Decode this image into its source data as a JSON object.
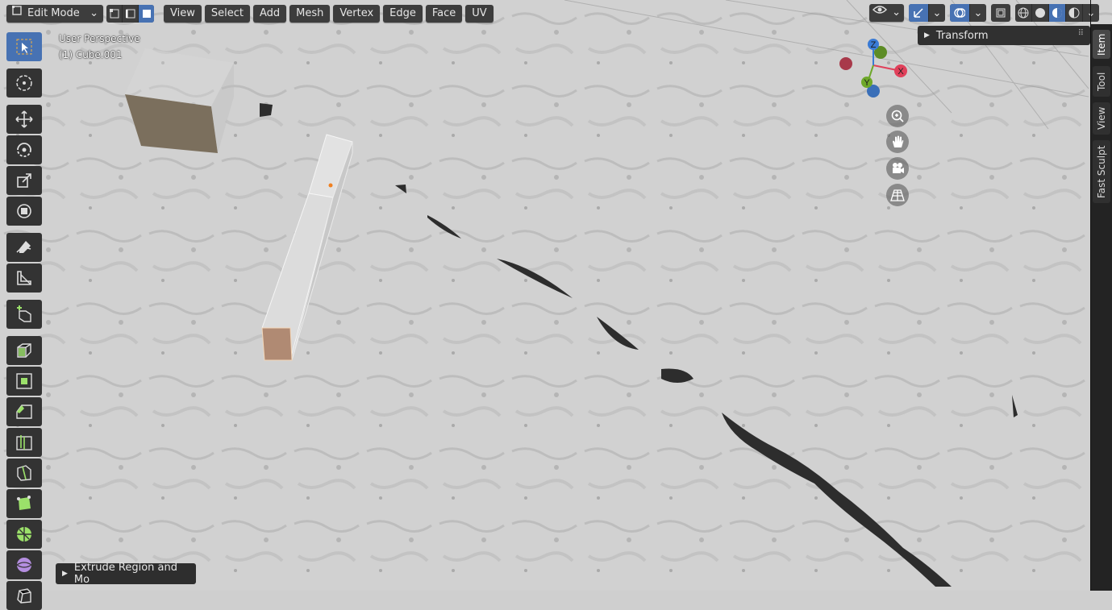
{
  "header": {
    "mode": "Edit Mode",
    "menus": [
      "View",
      "Select",
      "Add",
      "Mesh",
      "Vertex",
      "Edge",
      "Face",
      "UV"
    ],
    "select_modes": [
      "vertex-select",
      "edge-select",
      "face-select"
    ],
    "active_select_mode": "face-select"
  },
  "viewport": {
    "perspective": "User Perspective",
    "object": "(1) Cube.001"
  },
  "gizmo": {
    "x": "X",
    "y": "Y",
    "z": "Z"
  },
  "npanel": {
    "transform_label": "Transform",
    "tabs": [
      "Item",
      "Tool",
      "View",
      "Fast Sculpt"
    ],
    "active_tab": "Item"
  },
  "last_operator": {
    "label": "Extrude Region and Mo"
  },
  "toolbar": {
    "tools": [
      "select-box",
      "cursor",
      "move",
      "rotate",
      "scale",
      "transform",
      "annotate",
      "measure",
      "add-cube",
      "extrude-region",
      "inset-faces",
      "bevel",
      "loop-cut",
      "knife",
      "poly-build",
      "spin",
      "smooth",
      "shrink-fatten"
    ],
    "active_tool": "select-box"
  },
  "colors": {
    "accent": "#4772b3",
    "axis_x": "#e0405a",
    "axis_y": "#6ea82a",
    "axis_z": "#3a7bd5"
  }
}
